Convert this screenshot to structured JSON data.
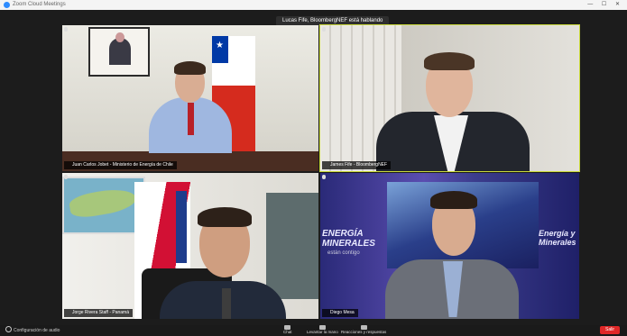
{
  "window": {
    "title": "Zoom Cloud Meetings",
    "controls": "— ☐ ✕"
  },
  "speaker_banner": "Lucas Fife, BloombergNEF está hablando",
  "tiles": [
    {
      "name": "Juan Carlos Jobet - Ministerio de Energía de Chile",
      "active": false
    },
    {
      "name": "James Fife - BloombergNEF",
      "active": true
    },
    {
      "name": "Jorge Rivera Staff - Panamá",
      "active": false
    },
    {
      "name": "Diego Mesa",
      "active": false
    }
  ],
  "tile4_backdrop": {
    "left_text": "ENERGÍA MINERALES",
    "left_sub": "están contigo",
    "right_text": "Energía y Minerales"
  },
  "toolbar": {
    "settings": "Configuración de audio",
    "chat": "Chat",
    "share": "Levantar la mano",
    "reactions": "Reacciones y respuestas",
    "leave": "Salir"
  },
  "colors": {
    "active_border": "#c9d83a",
    "leave": "#e02828",
    "chile_red": "#d52b1e",
    "chile_blue": "#0039a6"
  }
}
